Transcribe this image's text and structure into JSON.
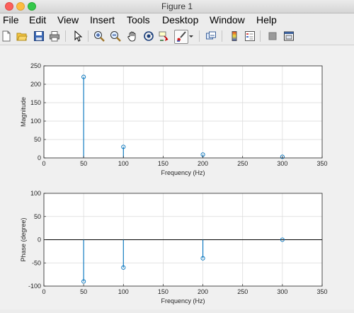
{
  "window": {
    "title": "Figure 1"
  },
  "menu": [
    "File",
    "Edit",
    "View",
    "Insert",
    "Tools",
    "Desktop",
    "Window",
    "Help"
  ],
  "toolbar": {
    "icons": [
      "new-figure-icon",
      "open-file-icon",
      "save-icon",
      "print-icon",
      "pointer-icon",
      "zoom-in-icon",
      "zoom-out-icon",
      "pan-icon",
      "rotate-3d-icon",
      "data-cursor-icon",
      "brush-icon",
      "brush-dropdown-icon",
      "link-plot-icon",
      "colorbar-icon",
      "legend-icon",
      "hide-plot-tools-icon",
      "show-plot-tools-icon"
    ]
  },
  "colors": {
    "stem": "#0072bd",
    "grid": "#d9d9d9",
    "axes_bg": "#ffffff"
  },
  "chart_data": [
    {
      "type": "stem",
      "title": "",
      "xlabel": "Frequency (Hz)",
      "ylabel": "Magnitude",
      "xlim": [
        0,
        350
      ],
      "ylim": [
        0,
        250
      ],
      "xticks": [
        0,
        50,
        100,
        150,
        200,
        250,
        300,
        350
      ],
      "yticks": [
        0,
        50,
        100,
        150,
        200,
        250
      ],
      "x": [
        50,
        100,
        200,
        300
      ],
      "y": [
        220,
        30,
        9,
        3
      ],
      "grid": true
    },
    {
      "type": "stem",
      "title": "",
      "xlabel": "Frequency (Hz)",
      "ylabel": "Phase (degree)",
      "xlim": [
        0,
        350
      ],
      "ylim": [
        -100,
        100
      ],
      "xticks": [
        0,
        50,
        100,
        150,
        200,
        250,
        300,
        350
      ],
      "yticks": [
        -100,
        -50,
        0,
        50,
        100
      ],
      "x": [
        50,
        100,
        200,
        300
      ],
      "y": [
        -90,
        -60,
        -40,
        0
      ],
      "grid": true
    }
  ]
}
